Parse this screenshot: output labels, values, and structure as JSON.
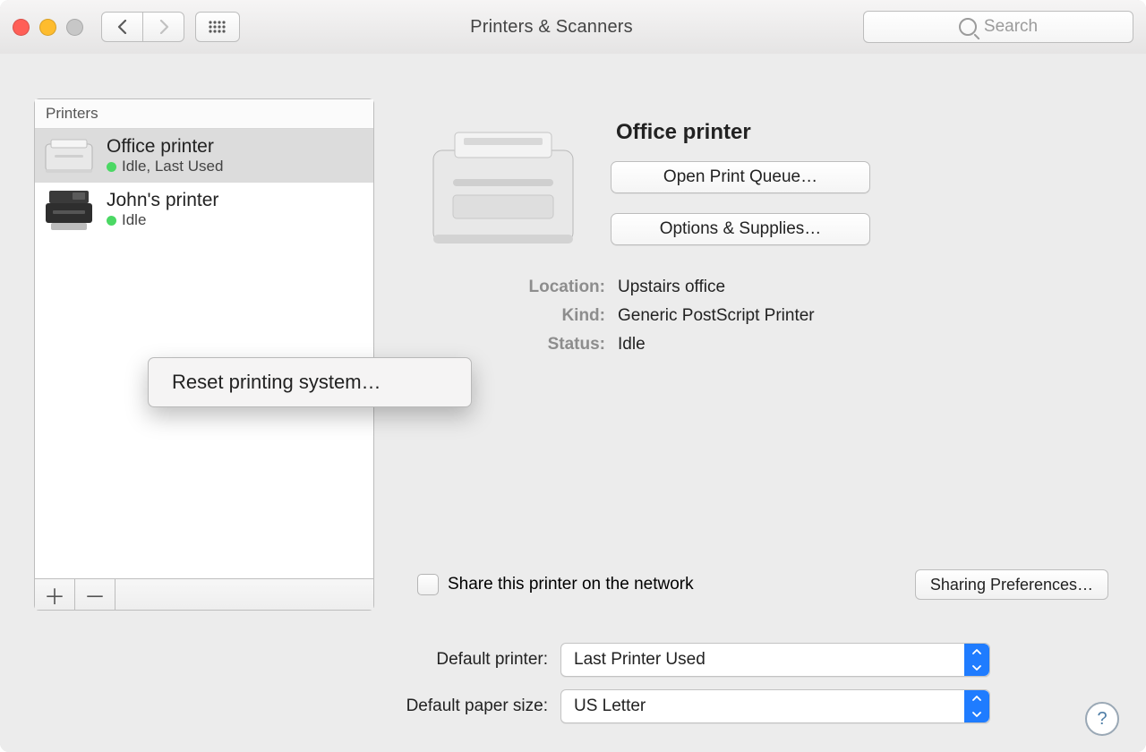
{
  "window": {
    "title": "Printers & Scanners"
  },
  "search": {
    "placeholder": "Search"
  },
  "sidebar": {
    "header": "Printers",
    "items": [
      {
        "name": "Office printer",
        "status": "Idle, Last Used"
      },
      {
        "name": "John's printer",
        "status": "Idle"
      }
    ]
  },
  "context_menu": {
    "reset_label": "Reset printing system…"
  },
  "detail": {
    "name": "Office printer",
    "open_queue_label": "Open Print Queue…",
    "options_label": "Options & Supplies…",
    "labels": {
      "location": "Location:",
      "kind": "Kind:",
      "status": "Status:"
    },
    "location": "Upstairs office",
    "kind": "Generic PostScript Printer",
    "status": "Idle",
    "share_label": "Share this printer on the network",
    "sharing_prefs_label": "Sharing Preferences…"
  },
  "defaults": {
    "printer_label": "Default printer:",
    "printer_value": "Last Printer Used",
    "paper_label": "Default paper size:",
    "paper_value": "US Letter"
  }
}
